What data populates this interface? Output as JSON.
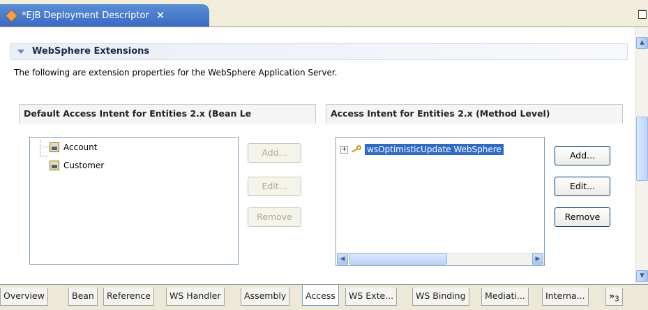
{
  "editor_tab": {
    "title": "*EJB Deployment Descriptor",
    "close_label": "✕"
  },
  "section": {
    "title": "WebSphere Extensions",
    "description": "The following are extension properties for the WebSphere Application Server."
  },
  "left_group": {
    "title": "Default Access Intent for Entities 2.x  (Bean Le",
    "items": [
      "Account",
      "Customer"
    ],
    "buttons": {
      "add": "Add...",
      "edit": "Edit...",
      "remove": "Remove"
    }
  },
  "right_group": {
    "title": "Access Intent for Entities 2.x  (Method Level)",
    "items": [
      "wsOptimisticUpdate WebSphere"
    ],
    "buttons": {
      "add": "Add...",
      "edit": "Edit...",
      "remove": "Remove"
    }
  },
  "page_tabs": [
    "Overview",
    "Bean",
    "Reference",
    "WS Handler",
    "Assembly",
    "Access",
    "WS Exte...",
    "WS Binding",
    "Mediati...",
    "Interna..."
  ],
  "overflow_label": "»",
  "overflow_count": "3",
  "active_tab": "Access"
}
